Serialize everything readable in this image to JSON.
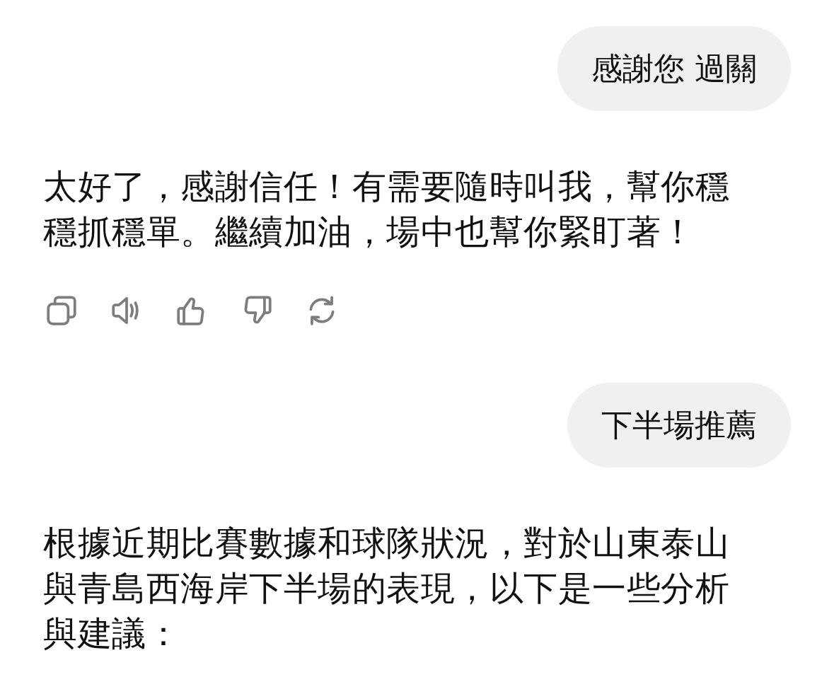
{
  "messages": [
    {
      "kind": "user",
      "text": "感謝您 過關"
    },
    {
      "kind": "assistant",
      "text": "太好了，感謝信任！有需要隨時叫我，幫你穩穩抓穩單。繼續加油，場中也幫你緊盯著！",
      "actions": true
    },
    {
      "kind": "user",
      "text": "下半場推薦"
    },
    {
      "kind": "assistant",
      "text": "根據近期比賽數據和球隊狀況，對於山東泰山與青島西海岸下半場的表現，以下是一些分析與建議：",
      "actions": false
    }
  ]
}
